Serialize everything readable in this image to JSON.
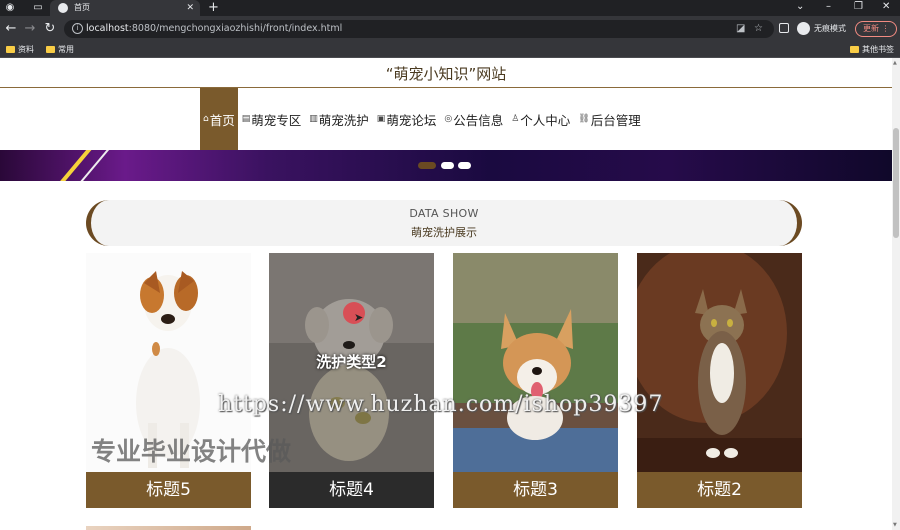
{
  "browser": {
    "tab_title": "首页",
    "url_host": "localhost",
    "url_rest": ":8080/mengchongxiaozhishi/front/index.html",
    "profile_label": "无痕模式",
    "update_label": "更新",
    "bookmarks": [
      "资料",
      "常用"
    ],
    "other_bookmarks": "其他书签"
  },
  "site": {
    "title": "“萌宠小知识”网站",
    "menu": [
      {
        "label": "首页",
        "icon": "home-icon",
        "glyph": "⌂",
        "active": true
      },
      {
        "label": "萌宠专区",
        "icon": "grid-icon",
        "glyph": "▤",
        "active": false
      },
      {
        "label": "萌宠洗护",
        "icon": "grid-icon",
        "glyph": "▥",
        "active": false
      },
      {
        "label": "萌宠论坛",
        "icon": "doc-icon",
        "glyph": "▣",
        "active": false
      },
      {
        "label": "公告信息",
        "icon": "bell-icon",
        "glyph": "◎",
        "active": false
      },
      {
        "label": "个人中心",
        "icon": "user-icon",
        "glyph": "♙",
        "active": false
      },
      {
        "label": "后台管理",
        "icon": "link-icon",
        "glyph": "⛓",
        "active": false
      }
    ],
    "banner_dots_active": 0
  },
  "section": {
    "en_title": "DATA SHOW",
    "cn_title": "萌宠洗护展示"
  },
  "cards": [
    {
      "label": "标题5",
      "image": "white-brown-dog"
    },
    {
      "label": "标题4",
      "image": "white-puppy-in-sweater",
      "overlay": "洗护类型2"
    },
    {
      "label": "标题3",
      "image": "corgi-dog"
    },
    {
      "label": "标题2",
      "image": "tabby-cat"
    }
  ],
  "watermarks": {
    "url": "https://www.huzhan.com/ishop39397",
    "cn": "专业毕业设计代做"
  },
  "colors": {
    "accent_brown": "#7a5a2c",
    "banner_purple": "#3a1260",
    "cursor_red": "#e63c46"
  }
}
